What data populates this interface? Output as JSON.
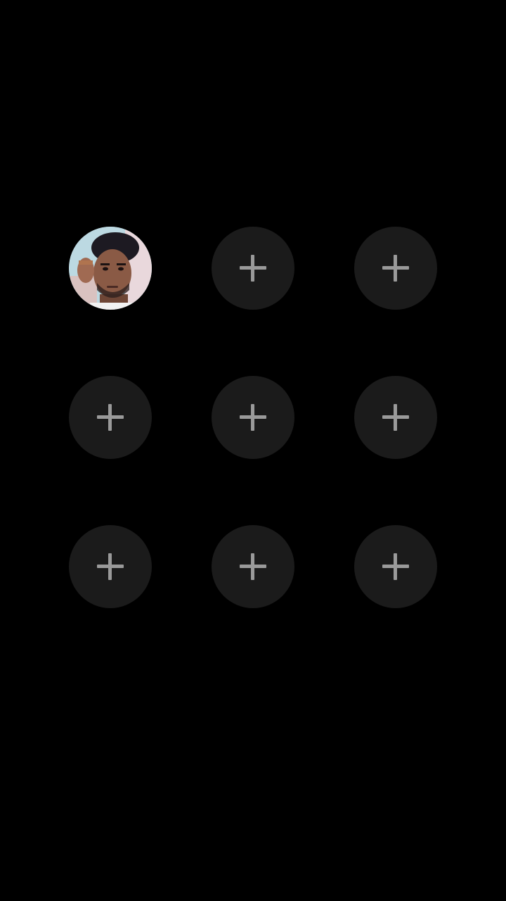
{
  "screen": {
    "background_color": "#000000"
  },
  "contacts_grid": {
    "slots": [
      {
        "type": "avatar",
        "icon": "person-avatar"
      },
      {
        "type": "add",
        "icon": "plus-icon"
      },
      {
        "type": "add",
        "icon": "plus-icon"
      },
      {
        "type": "add",
        "icon": "plus-icon"
      },
      {
        "type": "add",
        "icon": "plus-icon"
      },
      {
        "type": "add",
        "icon": "plus-icon"
      },
      {
        "type": "add",
        "icon": "plus-icon"
      },
      {
        "type": "add",
        "icon": "plus-icon"
      },
      {
        "type": "add",
        "icon": "plus-icon"
      }
    ],
    "slot_color": "#1b1b1b",
    "plus_color": "#9a9a9a"
  }
}
